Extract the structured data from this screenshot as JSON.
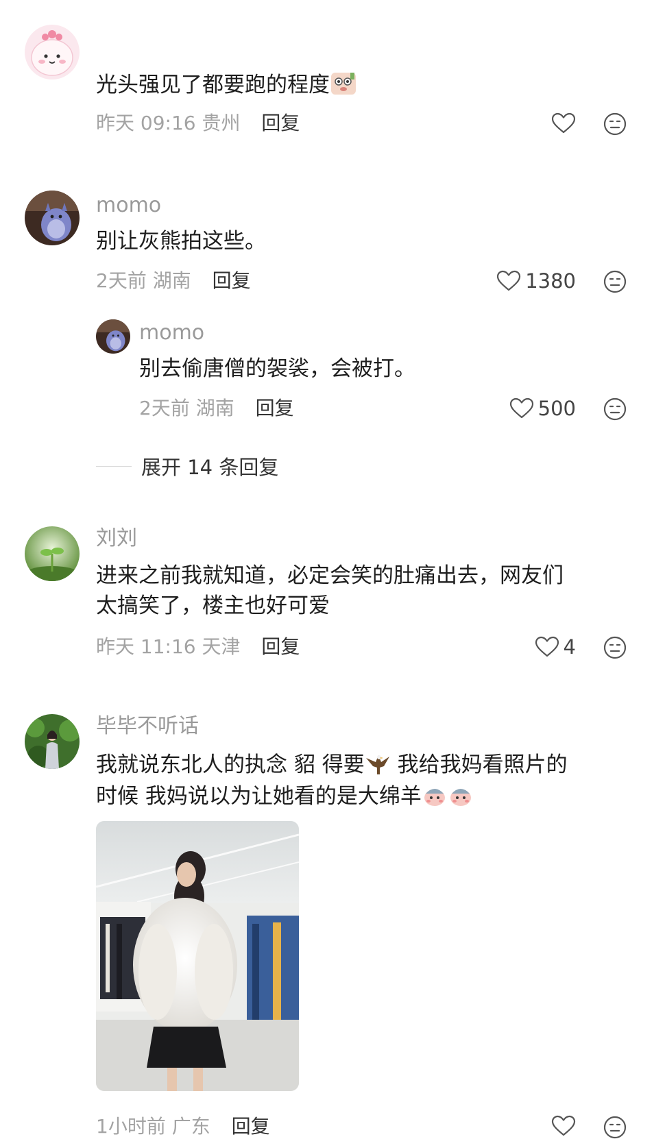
{
  "comments": [
    {
      "username": "",
      "text": "光头强见了都要跑的程度",
      "time": "昨天 09:16",
      "location": "贵州",
      "reply_label": "回复",
      "like_count": ""
    },
    {
      "username": "momo",
      "text": "别让灰熊拍这些。",
      "time": "2天前",
      "location": "湖南",
      "reply_label": "回复",
      "like_count": "1380",
      "sub_reply": {
        "username": "momo",
        "text": "别去偷唐僧的袈裟，会被打。",
        "time": "2天前",
        "location": "湖南",
        "reply_label": "回复",
        "like_count": "500"
      },
      "expand_label": "展开 14 条回复"
    },
    {
      "username": "刘刘",
      "text_lines": [
        "进来之前我就知道，必定会笑的肚痛出去，网友们",
        "太搞笑了，楼主也好可爱"
      ],
      "time": "昨天 11:16",
      "location": "天津",
      "reply_label": "回复",
      "like_count": "4"
    },
    {
      "username": "毕毕不听话",
      "text_line1_a": "我就说东北人的执念 貂 得要",
      "text_line1_b": " 我给我妈看照片的",
      "text_line2": "时候 我妈说以为让她看的是大绵羊",
      "time": "1小时前",
      "location": "广东",
      "reply_label": "回复"
    }
  ],
  "icons": {
    "like": "heart-outline-icon",
    "dislike": "neutral-face-icon"
  },
  "colors": {
    "meta_text": "#a3a3a3",
    "username": "#9a9a9a",
    "body_text": "#1e1e1e",
    "reply": "#333333"
  }
}
